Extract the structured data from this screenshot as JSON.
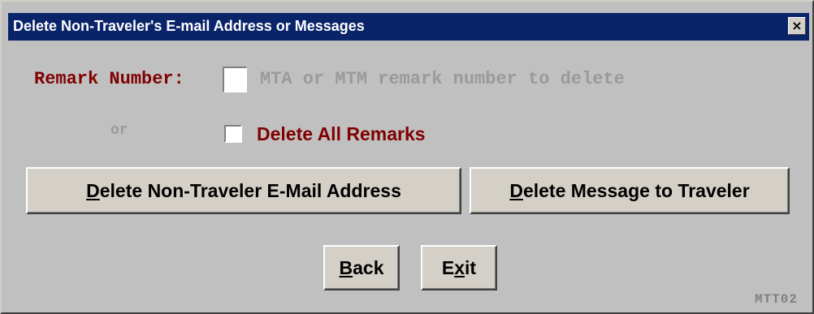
{
  "window": {
    "title": "Delete Non-Traveler's E-mail Address or Messages",
    "close_glyph": "×",
    "code": "MTT02"
  },
  "remark": {
    "label": "Remark Number:",
    "value": "",
    "hint": "MTA or MTM remark number to delete"
  },
  "or_label": "or",
  "delete_all": {
    "label": "Delete All Remarks",
    "checked": false
  },
  "buttons": {
    "delete_email": {
      "accel": "D",
      "rest": "elete Non-Traveler E-Mail Address"
    },
    "delete_message": {
      "accel": "D",
      "rest": "elete Message to Traveler"
    },
    "back": {
      "accel": "B",
      "rest": "ack"
    },
    "exit": {
      "pre": "E",
      "accel": "x",
      "rest": "it"
    }
  },
  "colors": {
    "titlebar": "#0a246a",
    "label_red": "#800000",
    "disabled_gray": "#9a9a9a",
    "face": "#c0c0c0"
  }
}
